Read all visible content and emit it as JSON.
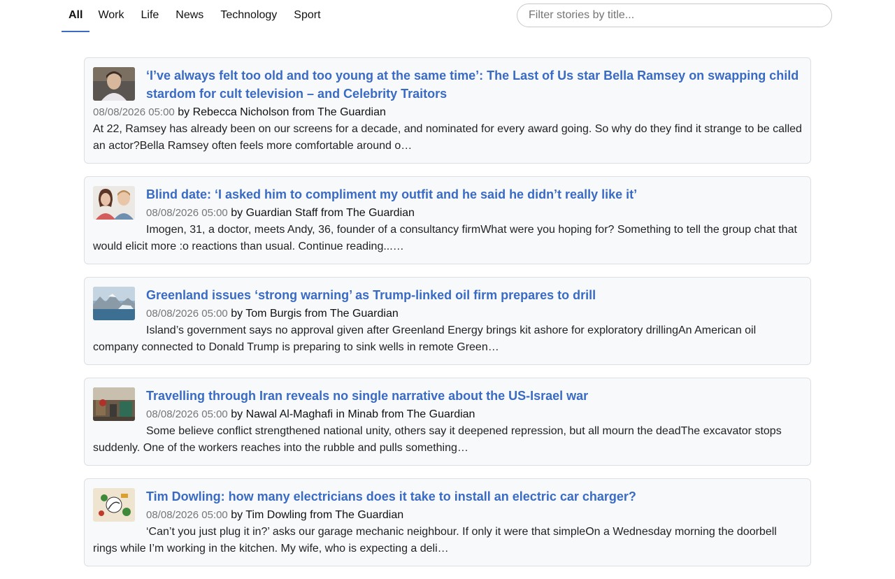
{
  "nav": {
    "tabs": [
      {
        "label": "All",
        "active": true
      },
      {
        "label": "Work"
      },
      {
        "label": "Life"
      },
      {
        "label": "News"
      },
      {
        "label": "Technology"
      },
      {
        "label": "Sport"
      }
    ]
  },
  "search": {
    "placeholder": "Filter stories by title...",
    "value": ""
  },
  "stories": [
    {
      "title": "‘I’ve always felt too old and too young at the same time’: The Last of Us star Bella Ramsey on swapping child stardom for cult television – and Celebrity Traitors",
      "date": "08/08/2026 05:00",
      "author": "Rebecca Nicholson",
      "source": "The Guardian",
      "summary": "At 22, Ramsey has already been on our screens for a decade, and nominated for every award going. So why do they find it strange to be called an actor?Bella Ramsey often feels more comfortable around o…",
      "thumb_icon": "portrait-photo"
    },
    {
      "title": "Blind date: ‘I asked him to compliment my outfit and he said he didn’t really like it’",
      "date": "08/08/2026 05:00",
      "author": "Guardian Staff",
      "source": "The Guardian",
      "summary": "Imogen, 31, a doctor, meets Andy, 36, founder of a consultancy firmWhat were you hoping for? Something to tell the group chat that would elicit more :o reactions than usual. Continue reading...…",
      "thumb_icon": "couple-photo"
    },
    {
      "title": "Greenland issues ‘strong warning’ as Trump-linked oil firm prepares to drill",
      "date": "08/08/2026 05:00",
      "author": "Tom Burgis",
      "source": "The Guardian",
      "summary": "Island’s government says no approval given after Greenland Energy brings kit ashore for exploratory drillingAn American oil company connected to Donald Trump is preparing to sink wells in remote Green…",
      "thumb_icon": "landscape-photo"
    },
    {
      "title": "Travelling through Iran reveals no single narrative about the US-Israel war",
      "date": "08/08/2026 05:00",
      "author": "Nawal Al-Maghafi in Minab",
      "source": "The Guardian",
      "summary": "Some believe conflict strengthened national unity, others say it deepened repression, but all mourn the deadThe excavator stops suddenly. One of the workers reaches into the rubble and pulls something…",
      "thumb_icon": "street-photo"
    },
    {
      "title": "Tim Dowling: how many electricians does it take to install an electric car charger?",
      "date": "08/08/2026 05:00",
      "author": "Tim Dowling",
      "source": "The Guardian",
      "summary": "‘Can’t you just plug it in?’ asks our garage mechanic neighbour. If only it were that simpleOn a Wednesday morning the doorbell rings while I’m working in the kitchen. My wife, who is expecting a deli…",
      "thumb_icon": "illustration"
    }
  ]
}
